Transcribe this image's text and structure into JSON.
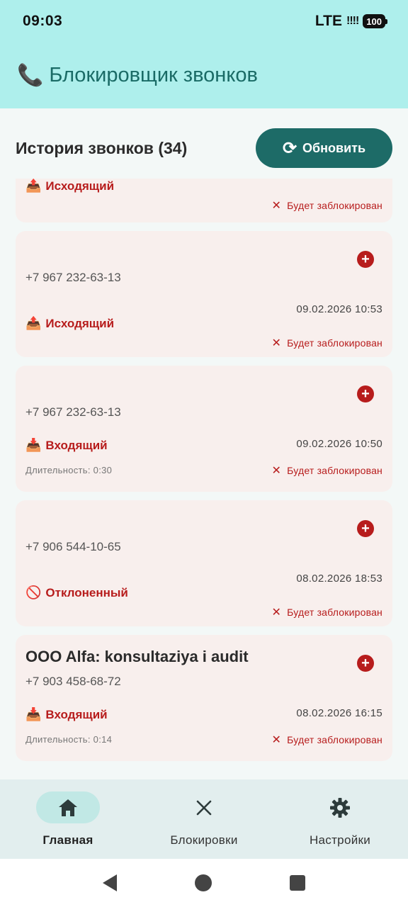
{
  "status": {
    "time": "09:03",
    "network": "LTE",
    "signal": "!!!!",
    "battery": "100"
  },
  "app": {
    "title": "Блокировщик звонков",
    "icon": "📞"
  },
  "history": {
    "title": "История звонков (34)",
    "refresh_label": "Обновить",
    "refresh_icon": "⟳"
  },
  "calls": [
    {
      "name": "",
      "number": "",
      "datetime": "",
      "type": "Исходящий",
      "type_icon": "📤",
      "duration": "",
      "status": "Будет заблокирован"
    },
    {
      "name": "",
      "number": "+7 967 232-63-13",
      "datetime": "09.02.2026 10:53",
      "type": "Исходящий",
      "type_icon": "📤",
      "duration": "",
      "status": "Будет заблокирован"
    },
    {
      "name": "",
      "number": "+7 967 232-63-13",
      "datetime": "09.02.2026 10:50",
      "type": "Входящий",
      "type_icon": "📥",
      "duration": "Длительность: 0:30",
      "status": "Будет заблокирован"
    },
    {
      "name": "",
      "number": "+7 906 544-10-65",
      "datetime": "08.02.2026 18:53",
      "type": "Отклоненный",
      "type_icon": "🚫",
      "duration": "",
      "status": "Будет заблокирован"
    },
    {
      "name": "OOO Alfa: konsultaziya i audit",
      "number": "+7 903 458-68-72",
      "datetime": "08.02.2026 16:15",
      "type": "Входящий",
      "type_icon": "📥",
      "duration": "Длительность: 0:14",
      "status": "Будет заблокирован"
    }
  ],
  "nav": [
    {
      "label": "Главная",
      "icon": "home-icon",
      "active": true
    },
    {
      "label": "Блокировки",
      "icon": "close-icon",
      "active": false
    },
    {
      "label": "Настройки",
      "icon": "gear-icon",
      "active": false
    }
  ],
  "colors": {
    "accent": "#1d6b67",
    "header_bg": "#aeefec",
    "danger": "#b71c1c",
    "card_bg": "#f8efed"
  }
}
